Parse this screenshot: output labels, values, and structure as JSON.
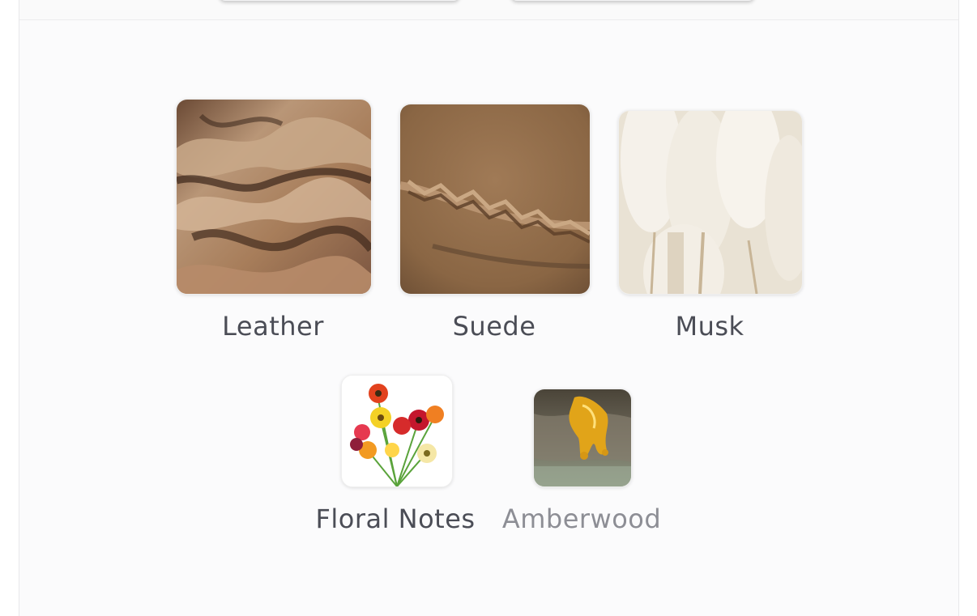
{
  "notes": [
    {
      "label": "Leather",
      "image": "leather-image"
    },
    {
      "label": "Suede",
      "image": "suede-image"
    },
    {
      "label": "Musk",
      "image": "musk-image"
    },
    {
      "label": "Floral Notes",
      "image": "flowers-image"
    },
    {
      "label": "Amberwood",
      "image": "amber-resin-image"
    }
  ],
  "colors": {
    "label": "#4b4d56",
    "label_muted": "#8d8e95",
    "panel_background": "#fbfbfc"
  }
}
